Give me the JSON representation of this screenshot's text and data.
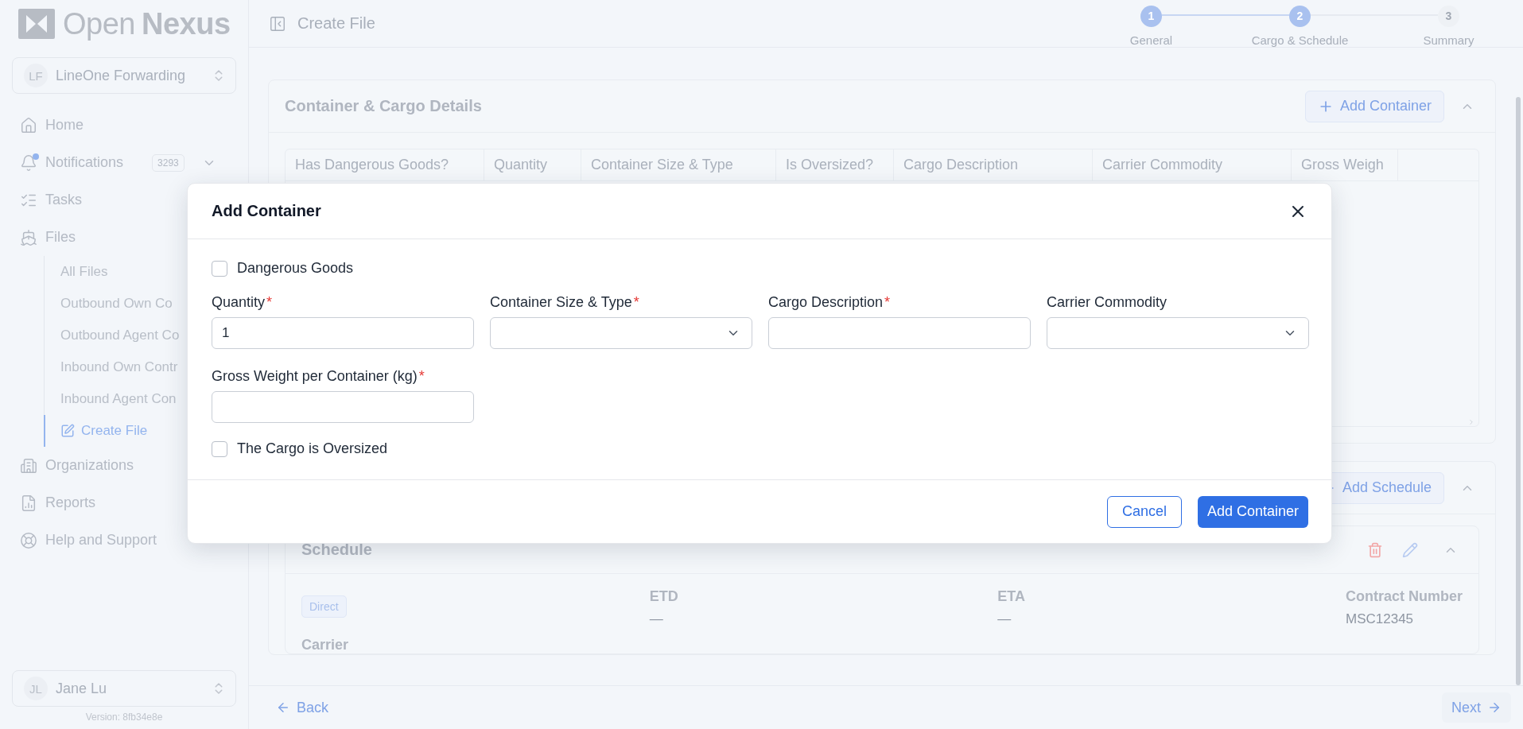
{
  "logo": {
    "light": "Open",
    "bold": "Nexus"
  },
  "org_switcher": {
    "initials": "LF",
    "name": "LineOne Forwarding"
  },
  "nav": [
    {
      "label": "Home",
      "selected": false
    },
    {
      "label": "Notifications",
      "selected": false,
      "badge": "3293",
      "unread": true,
      "expanded": false
    },
    {
      "label": "Tasks",
      "selected": false
    },
    {
      "label": "Files",
      "selected": false,
      "children": [
        {
          "label": "All Files",
          "selected": false
        },
        {
          "label": "Outbound Own Co",
          "selected": false
        },
        {
          "label": "Outbound Agent Co",
          "selected": false
        },
        {
          "label": "Inbound Own Contr",
          "selected": false
        },
        {
          "label": "Inbound Agent Con",
          "selected": false
        },
        {
          "label": "Create File",
          "selected": true
        }
      ]
    },
    {
      "label": "Organizations",
      "selected": false
    },
    {
      "label": "Reports",
      "selected": false
    },
    {
      "label": "Help and Support",
      "selected": false
    }
  ],
  "user_switcher": {
    "initials": "JL",
    "name": "Jane Lu"
  },
  "version": "Version: 8fb34e8e",
  "header": {
    "title": "Create File"
  },
  "stepper": [
    {
      "number": "1",
      "label": "General",
      "reached": true
    },
    {
      "number": "2",
      "label": "Cargo & Schedule",
      "reached": true
    },
    {
      "number": "3",
      "label": "Summary",
      "reached": false
    }
  ],
  "cargo_section": {
    "title": "Container & Cargo Details",
    "button": "Add Container",
    "expanded": true,
    "columns": [
      "Has Dangerous Goods?",
      "Quantity",
      "Container Size & Type",
      "Is Oversized?",
      "Cargo Description",
      "Carrier Commodity",
      "Gross Weigh"
    ]
  },
  "schedule_section": {
    "button": "Add Schedule",
    "expanded": true,
    "card": {
      "title": "Schedule",
      "expanded": true,
      "tag": "Direct",
      "fields": [
        {
          "label": "ETD",
          "value": "—"
        },
        {
          "label": "ETA",
          "value": "—"
        },
        {
          "label": "Contract Number",
          "value": "MSC12345"
        }
      ],
      "label_2": "Carrier"
    }
  },
  "footer": {
    "back": "Back",
    "next": "Next"
  },
  "modal": {
    "title": "Add Container",
    "dangerous": {
      "label": "Dangerous Goods",
      "checked": false
    },
    "fields": [
      {
        "kind": "input",
        "label": "Quantity",
        "required_mark": "*",
        "value": "1"
      },
      {
        "kind": "select",
        "label": "Container Size & Type",
        "required_mark": "*"
      },
      {
        "kind": "input",
        "label": "Cargo Description",
        "required_mark": "*"
      },
      {
        "kind": "select",
        "label": "Carrier Commodity"
      },
      {
        "kind": "input",
        "label": "Gross Weight per Container (kg)",
        "required_mark": "*"
      }
    ],
    "oversized": {
      "label": "The Cargo is Oversized",
      "checked": false
    },
    "cancel": "Cancel",
    "submit": "Add Container"
  }
}
